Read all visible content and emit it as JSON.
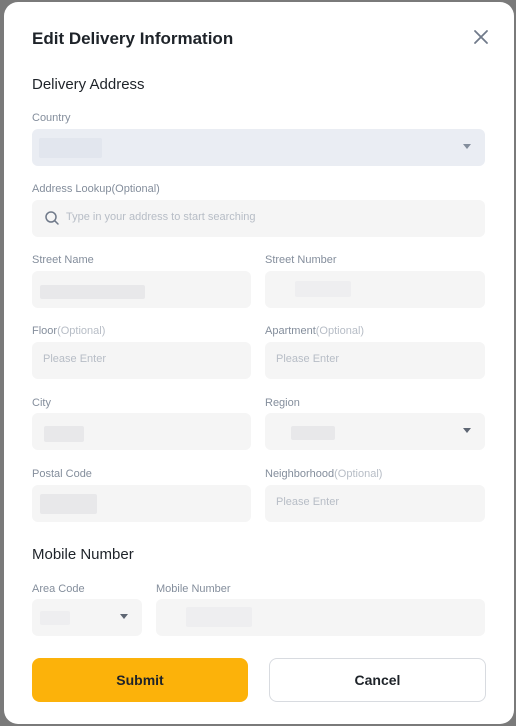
{
  "dialog": {
    "title": "Edit Delivery Information",
    "close_icon": "close-icon"
  },
  "delivery_address": {
    "heading": "Delivery Address",
    "country_label": "Country",
    "address_lookup_label": "Address Lookup",
    "address_lookup_optional": "(Optional)",
    "address_lookup_placeholder": "Type in your address to start searching",
    "street_name_label": "Street Name",
    "street_number_label": "Street Number",
    "floor_label": "Floor",
    "floor_optional": "(Optional)",
    "floor_placeholder": "Please Enter",
    "apartment_label": "Apartment",
    "apartment_optional": "(Optional)",
    "apartment_placeholder": "Please Enter",
    "city_label": "City",
    "region_label": "Region",
    "postal_code_label": "Postal Code",
    "neighborhood_label": "Neighborhood",
    "neighborhood_optional": "(Optional)",
    "neighborhood_placeholder": "Please Enter"
  },
  "mobile": {
    "heading": "Mobile Number",
    "area_code_label": "Area Code",
    "mobile_number_label": "Mobile Number"
  },
  "actions": {
    "submit_label": "Submit",
    "cancel_label": "Cancel"
  },
  "colors": {
    "accent": "#fcb20a",
    "label": "#848e9c",
    "placeholder": "#b7bdc6",
    "input_bg": "#f5f5f5"
  }
}
